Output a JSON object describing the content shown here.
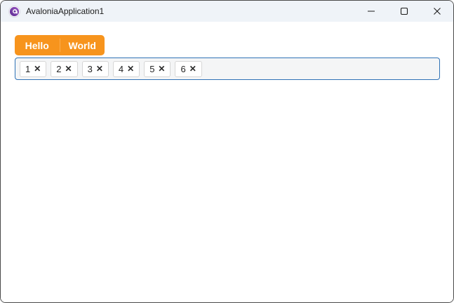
{
  "window": {
    "title": "AvaloniaApplication1",
    "controls": {
      "minimize_label": "Minimize",
      "maximize_label": "Maximize",
      "close_label": "Close"
    }
  },
  "tabs": [
    {
      "label": "Hello"
    },
    {
      "label": "World"
    }
  ],
  "chip_input": {
    "chips": [
      {
        "label": "1"
      },
      {
        "label": "2"
      },
      {
        "label": "3"
      },
      {
        "label": "4"
      },
      {
        "label": "5"
      },
      {
        "label": "6"
      }
    ],
    "remove_glyph": "✕"
  },
  "icons": {
    "app_logo": "avalonia-logo",
    "minimize": "minimize-icon",
    "maximize": "maximize-icon",
    "close": "close-icon",
    "chip_remove": "close-icon"
  },
  "colors": {
    "accent_orange": "#F7941D",
    "tab_divider_orange": "#FBAE4E",
    "tab_text": "#FFFFFF",
    "chip_container_border": "#2F72B6",
    "chip_container_bg": "#F4F5F6",
    "chip_bg": "#FFFFFF",
    "chip_border": "#D6D6D6",
    "chip_text": "#252525",
    "titlebar_bg": "#EFF3F8",
    "window_border": "#4A4A4A",
    "logo_purple": "#8B44AC",
    "title_text": "#1B1B1B",
    "content_bg": "#FFFFFF"
  }
}
